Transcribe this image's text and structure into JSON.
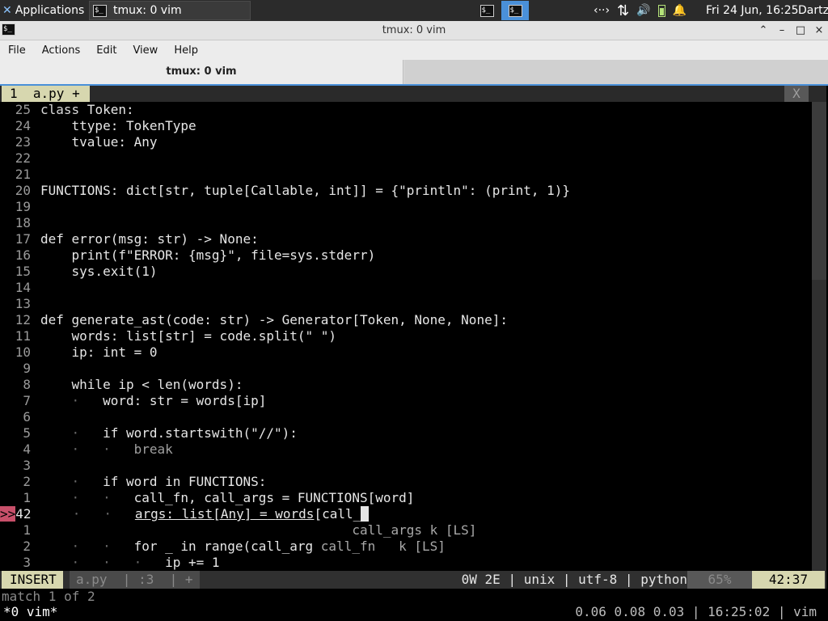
{
  "panel": {
    "applications_label": "Applications",
    "task_title": "tmux: 0 vim",
    "network_icon": "‹··›",
    "transfer_icon": "⇅",
    "volume_icon": "🔊",
    "bell_icon": "🔔",
    "clock": "Fri 24 Jun, 16:25",
    "user": "Dartz"
  },
  "window": {
    "title": "tmux: 0 vim",
    "controls": {
      "shade": "⌃",
      "minimize": "–",
      "maximize": "□",
      "close": "×"
    }
  },
  "menu": [
    "File",
    "Actions",
    "Edit",
    "View",
    "Help"
  ],
  "tab": {
    "label": "tmux: 0 vim"
  },
  "vim": {
    "tabline": {
      "active": "1  a.py +",
      "close": "X"
    },
    "lines": {
      "l25": {
        "n": "25",
        "a": "class",
        "b": " Token:"
      },
      "l24": {
        "n": "24",
        "a": "    ttype: TokenType"
      },
      "l23": {
        "n": "23",
        "a": "    tvalue: Any"
      },
      "l22": {
        "n": "22"
      },
      "l21": {
        "n": "21"
      },
      "l20": {
        "n": "20",
        "a": "FUNCTIONS: dict[str, tuple[Callable, int]] = {\"println\": (print, 1)}"
      },
      "l19": {
        "n": "19"
      },
      "l18": {
        "n": "18"
      },
      "l17": {
        "n": "17",
        "a": "def error(msg: str) -> None:"
      },
      "l16": {
        "n": "16",
        "a": "    print(f\"ERROR: {msg}\", file=sys.stderr)"
      },
      "l15": {
        "n": "15",
        "a": "    sys.exit(1)"
      },
      "l14": {
        "n": "14"
      },
      "l13": {
        "n": "13"
      },
      "l12": {
        "n": "12",
        "a": "def generate_ast(code: str) -> Generator[Token, None, None]:"
      },
      "l11": {
        "n": "11",
        "a": "    words: list[str] = code.split(\" \")"
      },
      "l10": {
        "n": "10",
        "a": "    ip: int = 0"
      },
      "l9": {
        "n": "9"
      },
      "l8": {
        "n": "8",
        "a": "    while ip < len(words):"
      },
      "l7": {
        "n": "7",
        "g": "    ·   ",
        "a": "word: str = words[ip]"
      },
      "l6": {
        "n": "6"
      },
      "l5": {
        "n": "5",
        "g": "    ·   ",
        "a": "if word.startswith(\"//\"):"
      },
      "l4": {
        "n": "4",
        "g": "    ·   ·   ",
        "a": "break"
      },
      "l3": {
        "n": "3"
      },
      "l2": {
        "n": "2",
        "g": "    ·   ",
        "a": "if word in FUNCTIONS:"
      },
      "l1": {
        "n": "1",
        "g": "    ·   ·   ",
        "a": "call_fn, call_args = FUNCTIONS[word]"
      },
      "cur": {
        "sign": ">>",
        "n": "42",
        "g": "    ·   ·   ",
        "u1": "args: list[Any] =",
        "sp": " ",
        "u2": "words",
        "rest": "[call_"
      },
      "n1": {
        "n": "1",
        "pum": "                                        call_args k [LS]"
      },
      "n2": {
        "n": "2",
        "g": "    ·   ·   ",
        "a": "for _ in range(call_arg ",
        "pum": "call_fn   k [LS]"
      },
      "n3": {
        "n": "3",
        "g": "    ·   ·   ·   ",
        "a": "ip += 1"
      }
    },
    "status": {
      "mode": "INSERT",
      "file": "a.py  | :3  | +",
      "right": "0W 2E | unix | utf-8 | python",
      "percent": "65%",
      "position": "42:37"
    },
    "cmdline": "match 1 of 2"
  },
  "tmux": {
    "left": "*0 vim*",
    "right": "0.06 0.08 0.03 | 16:25:02 | vim"
  }
}
